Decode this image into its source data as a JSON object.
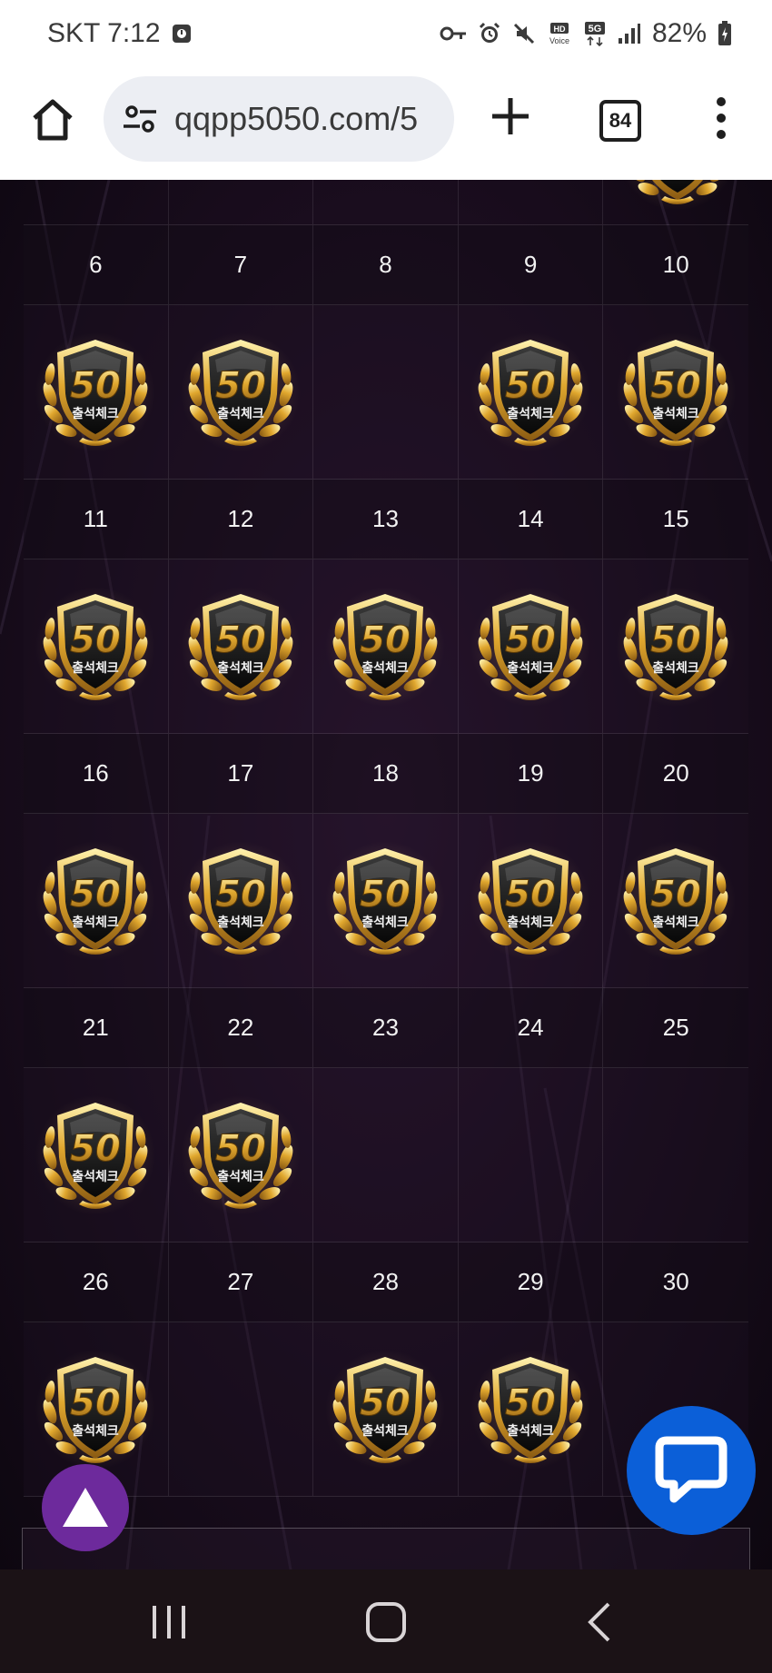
{
  "status_bar": {
    "carrier_time": "SKT 7:12",
    "battery": "82%",
    "icons": [
      "media-icon",
      "vpn-key-icon",
      "alarm-icon",
      "mute-icon",
      "hd-voice-icon",
      "5g-icon",
      "signal-icon",
      "battery-icon"
    ]
  },
  "browser": {
    "url": "qqpp5050.com/5",
    "tab_count": "84",
    "icons": [
      "home-icon",
      "site-settings-icon",
      "new-tab-icon",
      "tabs-icon",
      "more-menu-icon"
    ]
  },
  "calendar": {
    "badge_text_number": "50",
    "badge_text_label": "출석체크",
    "weeks": [
      {
        "days": [
          "6",
          "7",
          "8",
          "9",
          "10"
        ],
        "checked": [
          true,
          true,
          false,
          true,
          true
        ]
      },
      {
        "days": [
          "11",
          "12",
          "13",
          "14",
          "15"
        ],
        "checked": [
          true,
          true,
          true,
          true,
          true
        ]
      },
      {
        "days": [
          "16",
          "17",
          "18",
          "19",
          "20"
        ],
        "checked": [
          true,
          true,
          true,
          true,
          true
        ]
      },
      {
        "days": [
          "21",
          "22",
          "23",
          "24",
          "25"
        ],
        "checked": [
          true,
          true,
          false,
          false,
          false
        ]
      },
      {
        "days": [
          "26",
          "27",
          "28",
          "29",
          "30"
        ],
        "checked": [
          true,
          false,
          true,
          true,
          false
        ]
      }
    ]
  },
  "floating": {
    "scroll_top_icon": "triangle-up-icon",
    "chat_icon": "chat-bubble-icon"
  },
  "navbar": {
    "icons": [
      "recents-icon",
      "home-circle-icon",
      "back-icon"
    ]
  }
}
